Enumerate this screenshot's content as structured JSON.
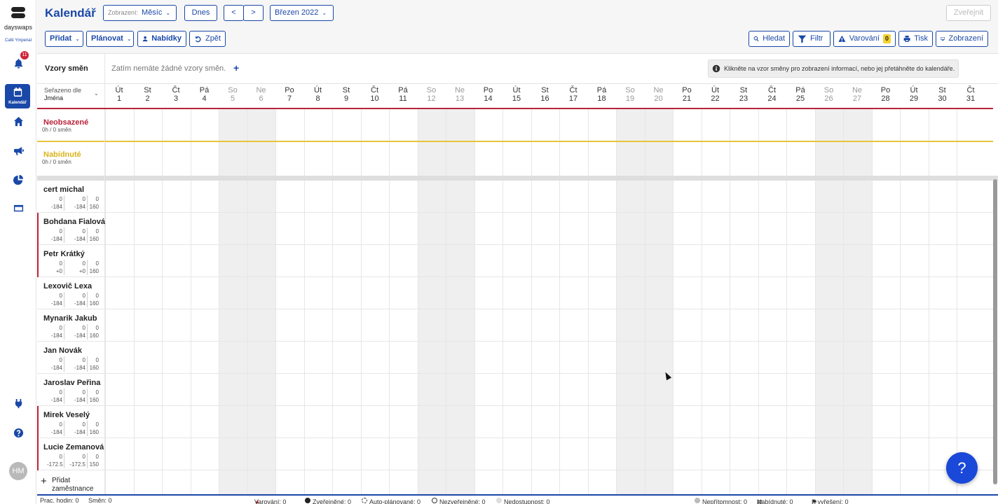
{
  "app": {
    "brand": "dayswaps",
    "company": "Café Ymperial"
  },
  "sidebar": {
    "notification_count": "11",
    "active_label": "Kalendář",
    "avatar": "HM",
    "icons": [
      "bell-icon",
      "calendar-icon",
      "home-icon",
      "megaphone-icon",
      "pie-chart-icon",
      "card-icon",
      "plug-icon",
      "help-icon"
    ]
  },
  "toolbar": {
    "title": "Kalendář",
    "view_label": "Zobrazení:",
    "view_value": "Měsíc",
    "today": "Dnes",
    "prev": "<",
    "next": ">",
    "period": "Březen 2022",
    "publish": "Zveřejnit",
    "add": "Přidat",
    "plan": "Plánovat",
    "offers": "Nabídky",
    "undo": "Zpět",
    "search": "Hledat",
    "filter": "Filtr",
    "warnings": "Varování",
    "warnings_count": "0",
    "print": "Tisk",
    "display": "Zobrazení"
  },
  "templates": {
    "label": "Vzory směn",
    "empty": "Zatím nemáte žádné vzory směn.",
    "add": "+",
    "info": "Klikněte na vzor směny pro zobrazení informací, nebo jej přetáhněte do kalendáře."
  },
  "sort": {
    "label": "Seřazeno dle",
    "value": "Jména"
  },
  "days": [
    {
      "w": "Út",
      "d": "1",
      "we": false
    },
    {
      "w": "St",
      "d": "2",
      "we": false
    },
    {
      "w": "Čt",
      "d": "3",
      "we": false
    },
    {
      "w": "Pá",
      "d": "4",
      "we": false
    },
    {
      "w": "So",
      "d": "5",
      "we": true
    },
    {
      "w": "Ne",
      "d": "6",
      "we": true
    },
    {
      "w": "Po",
      "d": "7",
      "we": false
    },
    {
      "w": "Út",
      "d": "8",
      "we": false
    },
    {
      "w": "St",
      "d": "9",
      "we": false
    },
    {
      "w": "Čt",
      "d": "10",
      "we": false
    },
    {
      "w": "Pá",
      "d": "11",
      "we": false
    },
    {
      "w": "So",
      "d": "12",
      "we": true
    },
    {
      "w": "Ne",
      "d": "13",
      "we": true
    },
    {
      "w": "Po",
      "d": "14",
      "we": false
    },
    {
      "w": "Út",
      "d": "15",
      "we": false
    },
    {
      "w": "St",
      "d": "16",
      "we": false
    },
    {
      "w": "Čt",
      "d": "17",
      "we": false
    },
    {
      "w": "Pá",
      "d": "18",
      "we": false
    },
    {
      "w": "So",
      "d": "19",
      "we": true
    },
    {
      "w": "Ne",
      "d": "20",
      "we": true
    },
    {
      "w": "Po",
      "d": "21",
      "we": false
    },
    {
      "w": "Út",
      "d": "22",
      "we": false
    },
    {
      "w": "St",
      "d": "23",
      "we": false
    },
    {
      "w": "Čt",
      "d": "24",
      "we": false
    },
    {
      "w": "Pá",
      "d": "25",
      "we": false
    },
    {
      "w": "So",
      "d": "26",
      "we": true
    },
    {
      "w": "Ne",
      "d": "27",
      "we": true
    },
    {
      "w": "Po",
      "d": "28",
      "we": false
    },
    {
      "w": "Út",
      "d": "29",
      "we": false
    },
    {
      "w": "St",
      "d": "30",
      "we": false
    },
    {
      "w": "Čt",
      "d": "31",
      "we": false
    }
  ],
  "sections": {
    "unassigned": {
      "name": "Neobsazené",
      "sub": "0h / 0 směn",
      "color": "#b8233a"
    },
    "offered": {
      "name": "Nabídnuté",
      "sub": "0h / 0 směn",
      "color": "#d9b41a"
    }
  },
  "employees": [
    {
      "name": "cert michal",
      "a1": "0",
      "a2": "-184",
      "b1": "0",
      "b2": "-184",
      "c1": "0",
      "c2": "160",
      "flag": false
    },
    {
      "name": "Bohdana Fialová",
      "a1": "0",
      "a2": "-184",
      "b1": "0",
      "b2": "-184",
      "c1": "0",
      "c2": "160",
      "flag": true
    },
    {
      "name": "Petr Krátký",
      "a1": "0",
      "a2": "+0",
      "b1": "0",
      "b2": "+0",
      "c1": "0",
      "c2": "160",
      "flag": true
    },
    {
      "name": "Lexovič Lexa",
      "a1": "0",
      "a2": "-184",
      "b1": "0",
      "b2": "-184",
      "c1": "0",
      "c2": "160",
      "flag": false
    },
    {
      "name": "Mynarik Jakub",
      "a1": "0",
      "a2": "-184",
      "b1": "0",
      "b2": "-184",
      "c1": "0",
      "c2": "160",
      "flag": false
    },
    {
      "name": "Jan Novák",
      "a1": "0",
      "a2": "-184",
      "b1": "0",
      "b2": "-184",
      "c1": "0",
      "c2": "160",
      "flag": false
    },
    {
      "name": "Jaroslav Peřina",
      "a1": "0",
      "a2": "-184",
      "b1": "0",
      "b2": "-184",
      "c1": "0",
      "c2": "160",
      "flag": false
    },
    {
      "name": "Mirek Veselý",
      "a1": "0",
      "a2": "-184",
      "b1": "0",
      "b2": "-184",
      "c1": "0",
      "c2": "160",
      "flag": true
    },
    {
      "name": "Lucie Zemanová",
      "a1": "0",
      "a2": "-172.5",
      "b1": "0",
      "b2": "-172.5",
      "c1": "0",
      "c2": "150",
      "flag": true
    }
  ],
  "add_employee": {
    "line1": "Přidat",
    "line2": "zaměstnance"
  },
  "help_button": "?",
  "status": {
    "hours": "Prac. hodin:  0",
    "shifts": "Směn:  0",
    "warnings": "Varování:  0",
    "published": "Zveřejněné:  0",
    "auto": "Auto-plánované:  0",
    "unpublished": "Nezveřejněné:  0",
    "unavail": "Nedostupnost:  0",
    "absence": "Nepřítomnost:  0",
    "offered": "Nabídnuté:  0",
    "resolve": "K vyřešení:  0"
  }
}
